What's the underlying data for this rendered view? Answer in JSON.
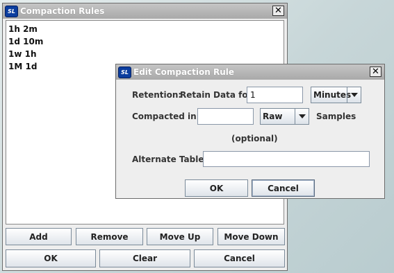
{
  "main_window": {
    "title": "Compaction Rules",
    "icon_text": "SL",
    "close_symbol": "✕",
    "rules": [
      "1h 2m",
      "1d 10m",
      "1w 1h",
      "1M 1d"
    ],
    "buttons": {
      "add": "Add",
      "remove": "Remove",
      "move_up": "Move Up",
      "move_down": "Move Down",
      "ok": "OK",
      "clear": "Clear",
      "cancel": "Cancel"
    }
  },
  "dialog": {
    "title": "Edit Compaction Rule",
    "icon_text": "SL",
    "close_symbol": "✕",
    "retention_label": "Retention:",
    "retain_data_label": "Retain Data for",
    "retain_value": "1",
    "retain_unit": "Minutes",
    "compacted_label": "Compacted in:",
    "compacted_value": "",
    "compacted_type": "Raw",
    "samples_label": "Samples",
    "optional_label": "(optional)",
    "alternate_table_label": "Alternate Table:",
    "alternate_table_value": "",
    "ok_label": "OK",
    "cancel_label": "Cancel"
  }
}
